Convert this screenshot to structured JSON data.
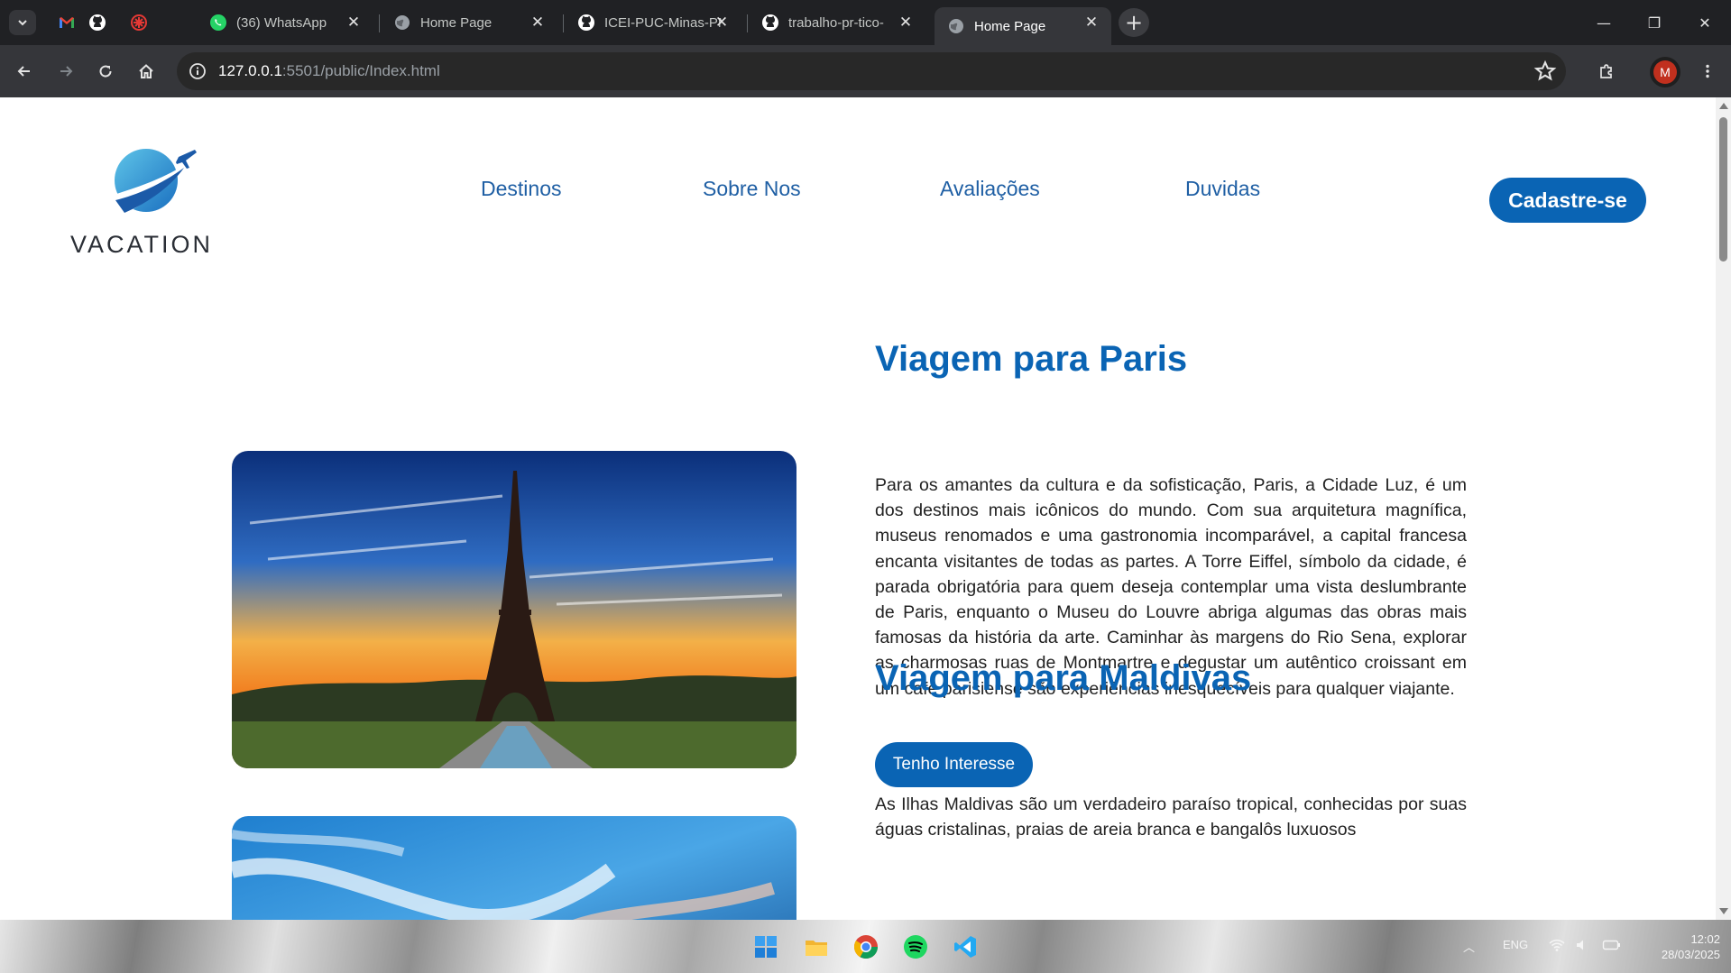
{
  "browser": {
    "tabs": [
      {
        "label": "(36) WhatsApp",
        "icon": "whatsapp-icon"
      },
      {
        "label": "Home Page",
        "icon": "globe-icon"
      },
      {
        "label": "ICEI-PUC-Minas-PMG",
        "icon": "github-icon"
      },
      {
        "label": "trabalho-pr-tico-",
        "icon": "github-icon"
      },
      {
        "label": "Home Page",
        "icon": "globe-icon",
        "active": true
      }
    ],
    "address": {
      "host": "127.0.0.1",
      "path": ":5501/public/Index.html"
    },
    "profile_initial": "M"
  },
  "site": {
    "logo_text": "VACATION",
    "nav": [
      "Destinos",
      "Sobre Nos",
      "Avaliações",
      "Duvidas"
    ],
    "cta": "Cadastre-se",
    "accent": "#0a64b4",
    "destinations": [
      {
        "title": "Viagem para Paris",
        "text": "Para os amantes da cultura e da sofisticação, Paris, a Cidade Luz, é um dos destinos mais icônicos do mundo. Com sua arquitetura magnífica, museus renomados e uma gastronomia incomparável, a capital francesa encanta visitantes de todas as partes. A Torre Eiffel, símbolo da cidade, é parada obrigatória para quem deseja contemplar uma vista deslumbrante de Paris, enquanto o Museu do Louvre abriga algumas das obras mais famosas da história da arte. Caminhar às margens do Rio Sena, explorar as charmosas ruas de Montmartre e degustar um autêntico croissant em um café parisiense são experiências inesquecíveis para qualquer viajante.",
        "button": "Tenho Interesse"
      },
      {
        "title": "Viagem para Maldivas",
        "text": "As Ilhas Maldivas são um verdadeiro paraíso tropical, conhecidas por suas águas cristalinas, praias de areia branca e bangalôs luxuosos"
      }
    ]
  },
  "taskbar": {
    "lang": "ENG",
    "time": "12:02",
    "date": "28/03/2025"
  }
}
